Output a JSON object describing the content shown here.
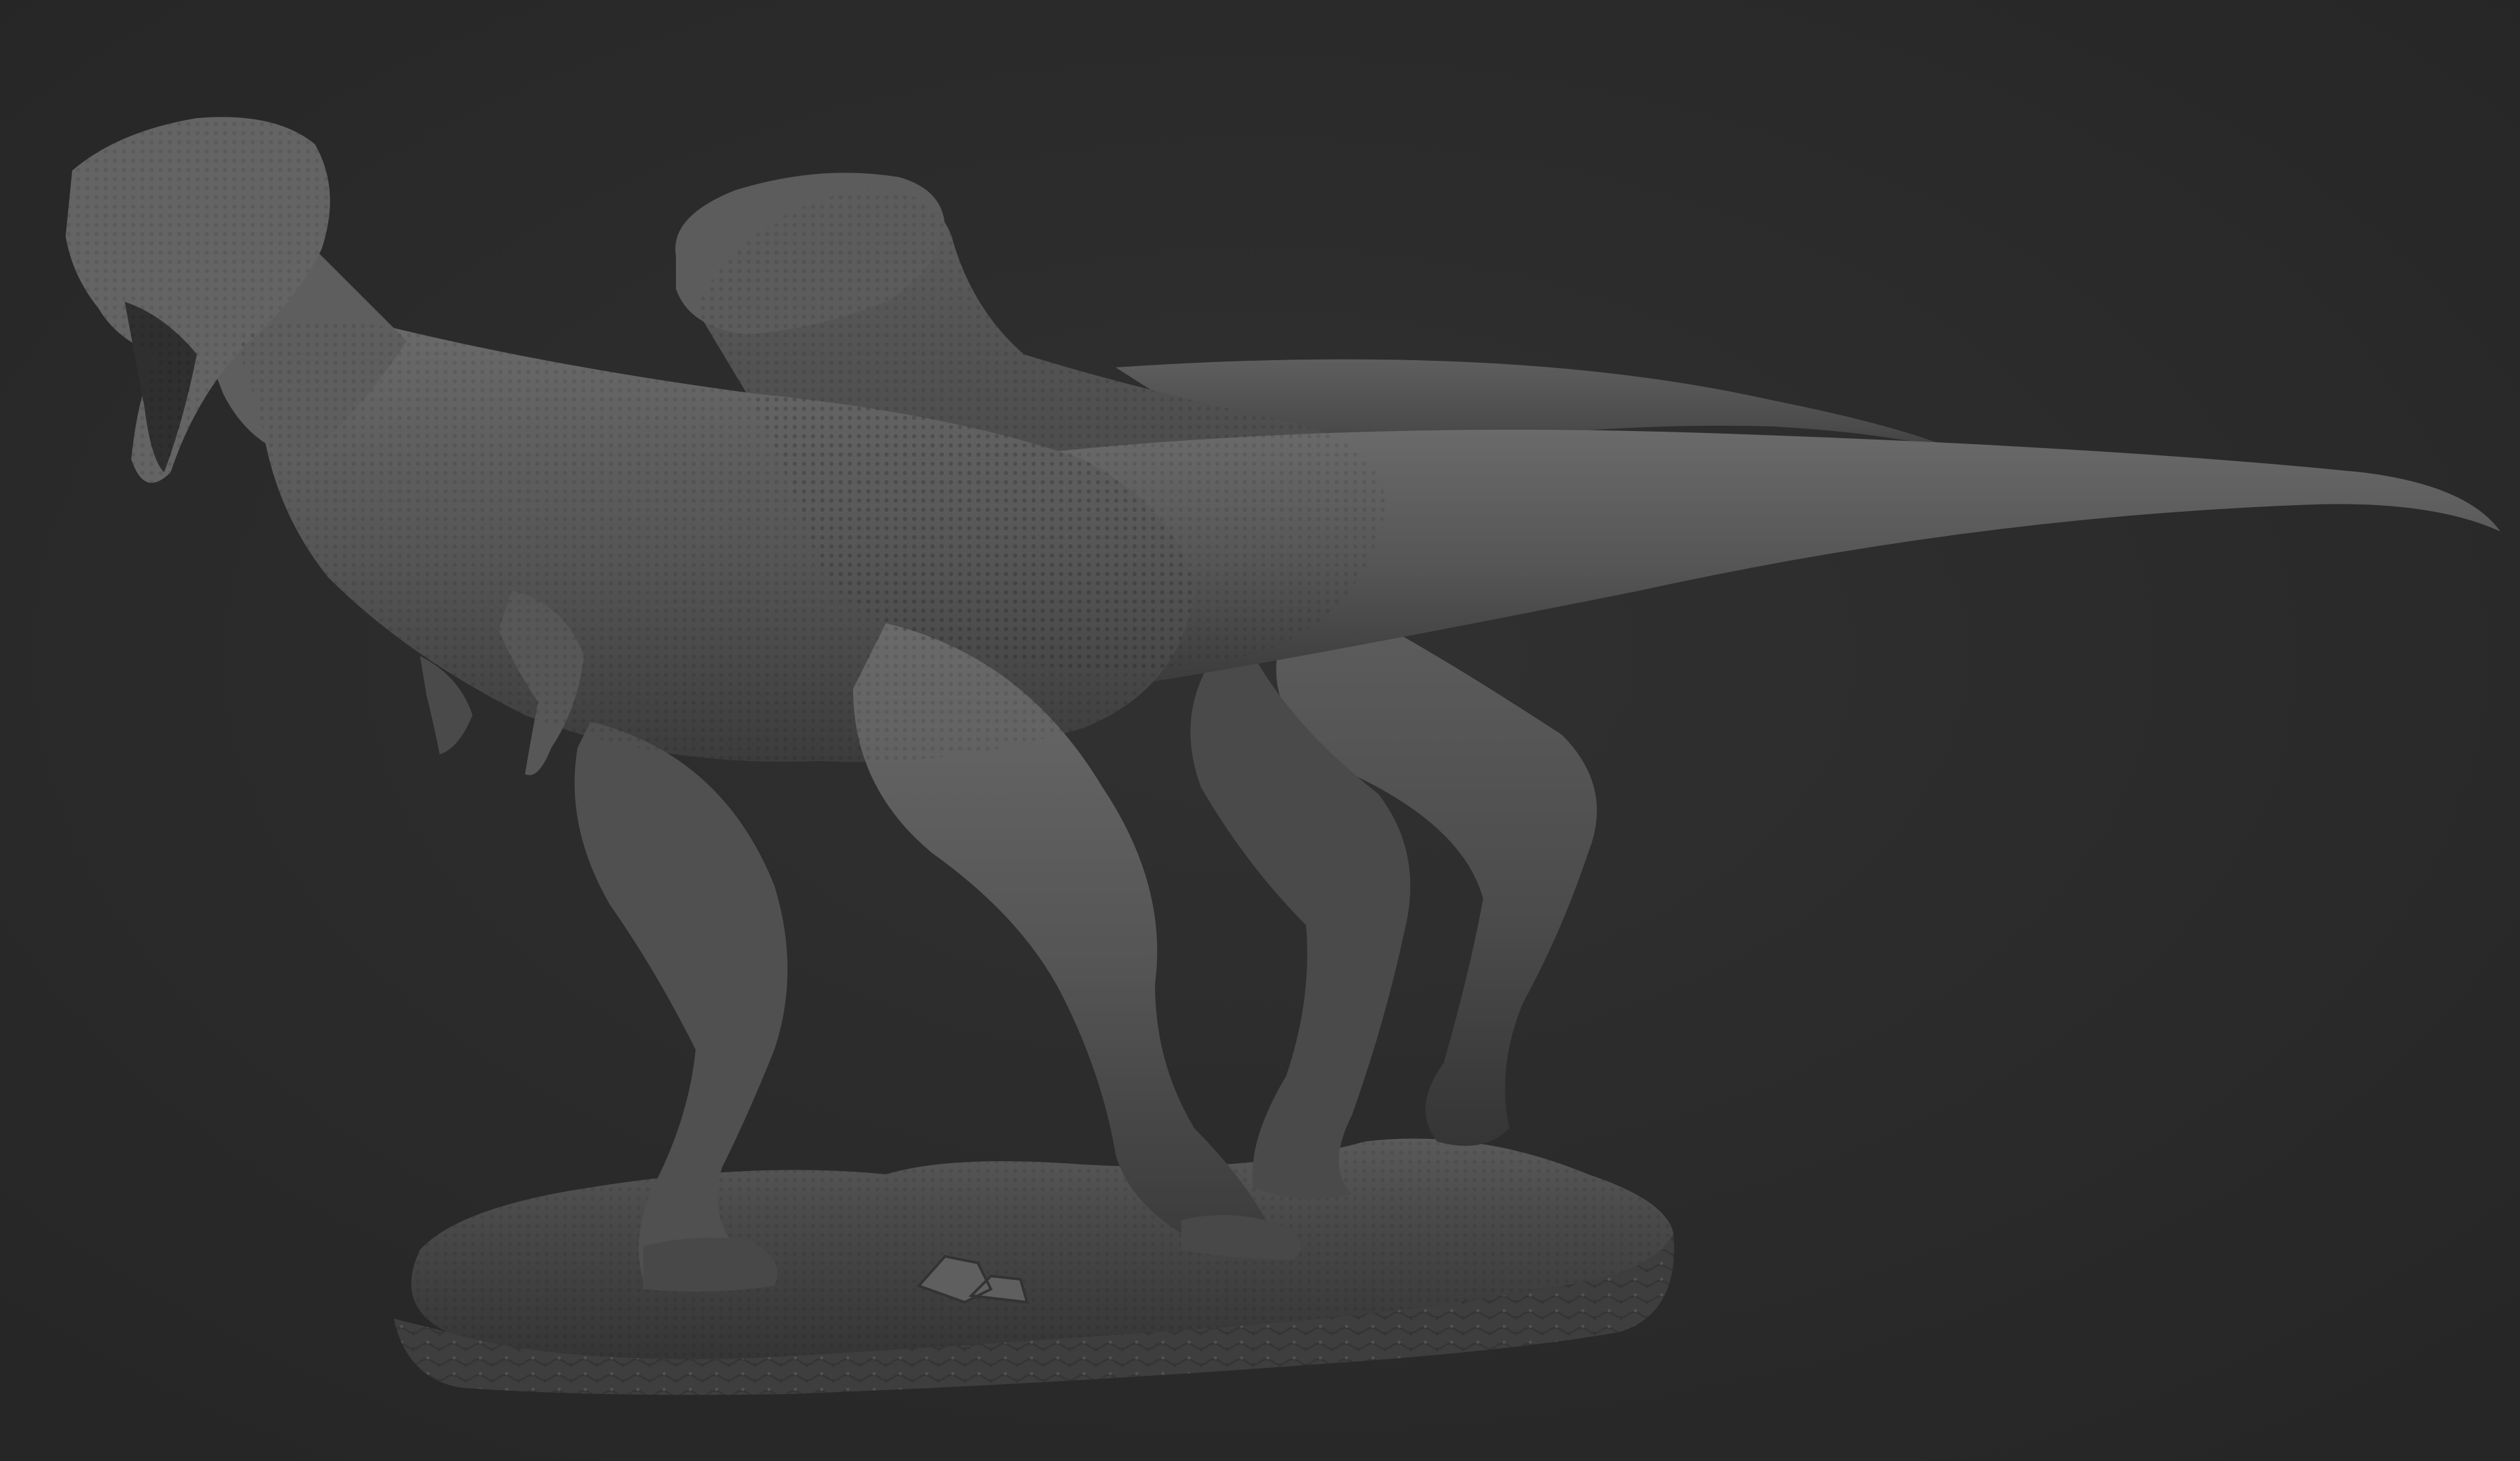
{
  "scene": {
    "subject": "two-theropod-sculpt-on-rock-base",
    "background_color": "#2b2b2b",
    "clay_color": "#5a5a5a",
    "clay_shadow": "#3a3a3a",
    "clay_highlight": "#7a7a7a",
    "base_color": "#4c4c4c"
  }
}
